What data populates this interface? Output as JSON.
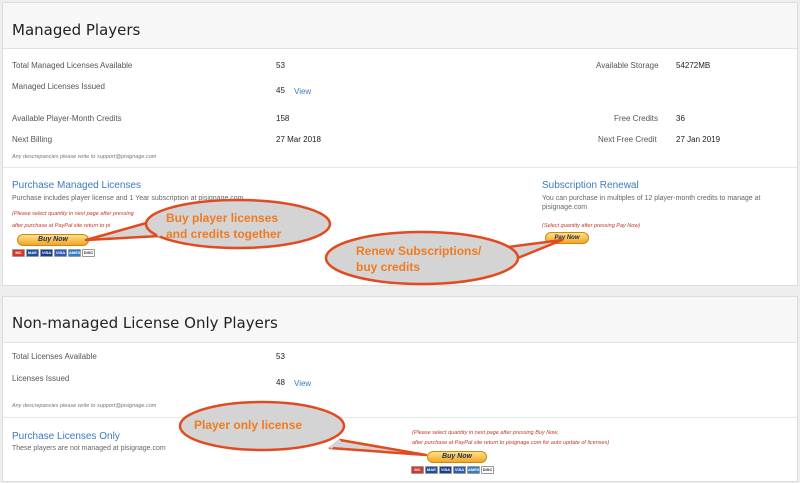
{
  "managed": {
    "title": "Managed Players",
    "total_label": "Total Managed Licenses Available",
    "total_value": "53",
    "storage_label": "Available Storage",
    "storage_value": "54272MB",
    "issued_label": "Managed Licenses Issued",
    "issued_value": "45",
    "view_label": "View",
    "credits_label": "Available Player-Month Credits",
    "credits_value": "158",
    "free_credits_label": "Free Credits",
    "free_credits_value": "36",
    "next_billing_label": "Next Billing",
    "next_billing_value": "27 Mar 2018",
    "next_free_label": "Next Free Credit",
    "next_free_value": "27 Jan 2019",
    "note": "Any descrepancies please write to support@pisignage.com",
    "purchase_title": "Purchase Managed Licenses",
    "purchase_desc": "Purchase includes player license and 1 Year subscription at pisignage.com",
    "purchase_red1": "(Please select quantity in next page after pressing",
    "purchase_red2": "after purchase at PayPal site return to pi",
    "buy_now": "Buy Now",
    "renewal_title": "Subscription Renewal",
    "renewal_desc1": "You can purchase in multiples of 12 player-month credits to manage at",
    "renewal_desc2": "pisignage.com",
    "renewal_red": "(Select quantity after pressing Pay Now)",
    "pay_now": "Pay Now"
  },
  "unmanaged": {
    "title": "Non-managed License Only Players",
    "total_label": "Total Licenses Available",
    "total_value": "53",
    "issued_label": "Licenses Issued",
    "issued_value": "48",
    "view_label": "View",
    "note": "Any descrepancies please write to support@pisignage.com",
    "purchase_title": "Purchase Licenses Only",
    "purchase_desc": "These players are not managed at pisignage.com",
    "red1": "(Please select quantity in next page after pressing Buy Now,",
    "red2": "after purchase at PayPal site return to pisignage.com for auto update of licenses)",
    "buy_now": "Buy Now"
  },
  "cards": [
    "MC",
    "MAE",
    "VISA",
    "VISA",
    "AMEX",
    "DISC"
  ],
  "callouts": {
    "c1_line1": "Buy player licenses",
    "c1_line2": "and credits together",
    "c2_line1": "Renew Subscriptions/",
    "c2_line2": "buy credits",
    "c3": "Player only license"
  },
  "colors": {
    "callout_fill": "#d4d4d4",
    "callout_stroke": "#e24a1f",
    "callout_text": "#f07b22",
    "link": "#3a7bbf"
  }
}
